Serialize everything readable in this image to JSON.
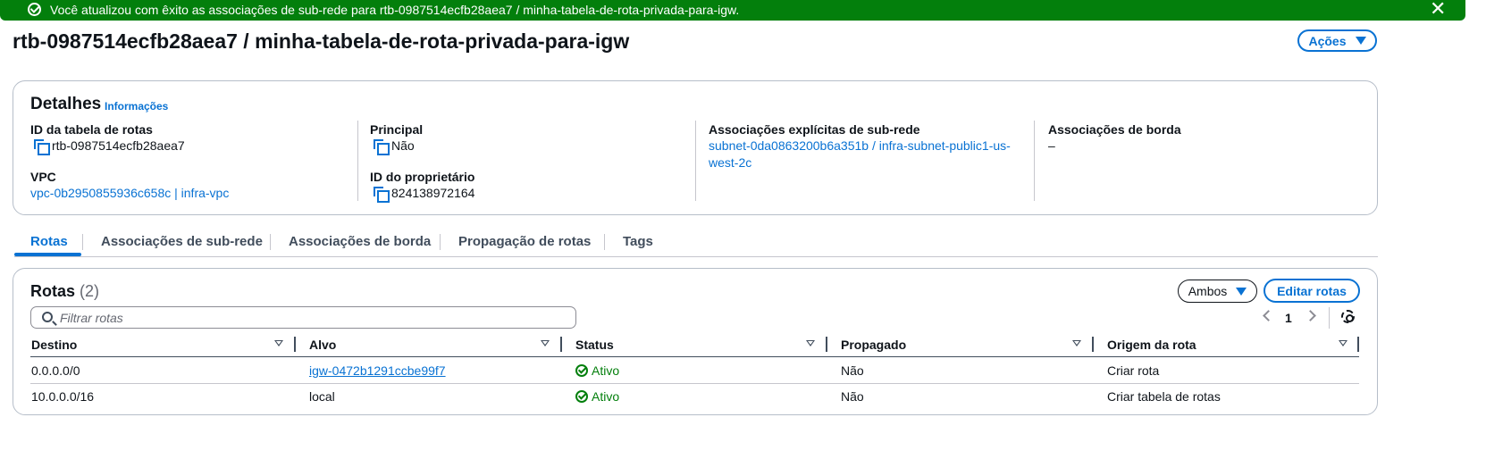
{
  "flash": {
    "message": "Você atualizou com êxito as associações de sub-rede para rtb-0987514ecfb28aea7 / minha-tabela-de-rota-privada-para-igw.",
    "icon": "success-check-icon",
    "close_icon": "close-icon",
    "color": "#037f0c"
  },
  "header": {
    "title": "rtb-0987514ecfb28aea7 / minha-tabela-de-rota-privada-para-igw",
    "actions_label": "Ações"
  },
  "details": {
    "title": "Detalhes",
    "info_link": "Informações",
    "route_table_id_label": "ID da tabela de rotas",
    "route_table_id": "rtb-0987514ecfb28aea7",
    "vpc_label": "VPC",
    "vpc": "vpc-0b2950855936c658c | infra-vpc",
    "main_label": "Principal",
    "main": "Não",
    "owner_id_label": "ID do proprietário",
    "owner_id": "824138972164",
    "explicit_assoc_label": "Associações explícitas de sub-rede",
    "explicit_assoc_line1": "subnet-0da0863200b6a351b / infra-subnet-public1-us-",
    "explicit_assoc_line2": "west-2c",
    "edge_assoc_label": "Associações de borda",
    "edge_assoc": "–"
  },
  "tabs": [
    {
      "label": "Rotas"
    },
    {
      "label": "Associações de sub-rede"
    },
    {
      "label": "Associações de borda"
    },
    {
      "label": "Propagação de rotas"
    },
    {
      "label": "Tags"
    }
  ],
  "routes": {
    "title": "Rotas",
    "count": "(2)",
    "filter_label": "Ambos",
    "edit_label": "Editar rotas",
    "search_placeholder": "Filtrar rotas",
    "page": "1",
    "columns": [
      "Destino",
      "Alvo",
      "Status",
      "Propagado",
      "Origem da rota"
    ],
    "rows": [
      {
        "destination": "0.0.0.0/0",
        "target": "igw-0472b1291ccbe99f7",
        "status": "Ativo",
        "propagated": "Não",
        "origin": "Criar rota"
      },
      {
        "destination": "10.0.0.0/16",
        "target": "local",
        "status": "Ativo",
        "propagated": "Não",
        "origin": "Criar tabela de rotas"
      }
    ]
  },
  "colors": {
    "accent": "#0972d3",
    "success": "#037f0c",
    "text": "#0f141a"
  }
}
